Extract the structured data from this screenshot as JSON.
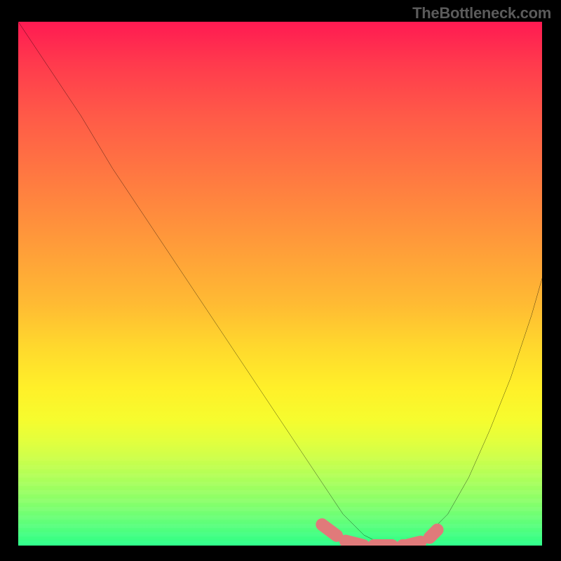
{
  "watermark": "TheBottleneck.com",
  "colors": {
    "page_bg": "#000000",
    "curve_main": "#000000",
    "curve_highlight": "#e07a7a"
  },
  "chart_data": {
    "type": "line",
    "title": "",
    "xlabel": "",
    "ylabel": "",
    "xlim": [
      0,
      100
    ],
    "ylim": [
      0,
      100
    ],
    "grid": false,
    "legend": false,
    "series": [
      {
        "name": "bottleneck-curve",
        "x": [
          0,
          6,
          12,
          18,
          24,
          30,
          36,
          42,
          48,
          54,
          58,
          62,
          66,
          70,
          74,
          78,
          82,
          86,
          90,
          94,
          98,
          100
        ],
        "values": [
          100,
          91,
          82,
          72,
          63,
          54,
          45,
          36,
          27,
          18,
          12,
          6,
          2,
          0,
          0,
          2,
          6,
          13,
          22,
          32,
          44,
          51
        ]
      },
      {
        "name": "optimal-zone-highlight",
        "x": [
          58,
          62,
          66,
          70,
          74,
          78,
          80
        ],
        "values": [
          4,
          1,
          0,
          0,
          0,
          1,
          3
        ]
      }
    ],
    "background_gradient_stops": [
      {
        "pos": 0,
        "color": "#ff1a52"
      },
      {
        "pos": 30,
        "color": "#ff7a41"
      },
      {
        "pos": 62,
        "color": "#ffd82d"
      },
      {
        "pos": 80,
        "color": "#e3ff3d"
      },
      {
        "pos": 100,
        "color": "#2eff8a"
      }
    ]
  }
}
